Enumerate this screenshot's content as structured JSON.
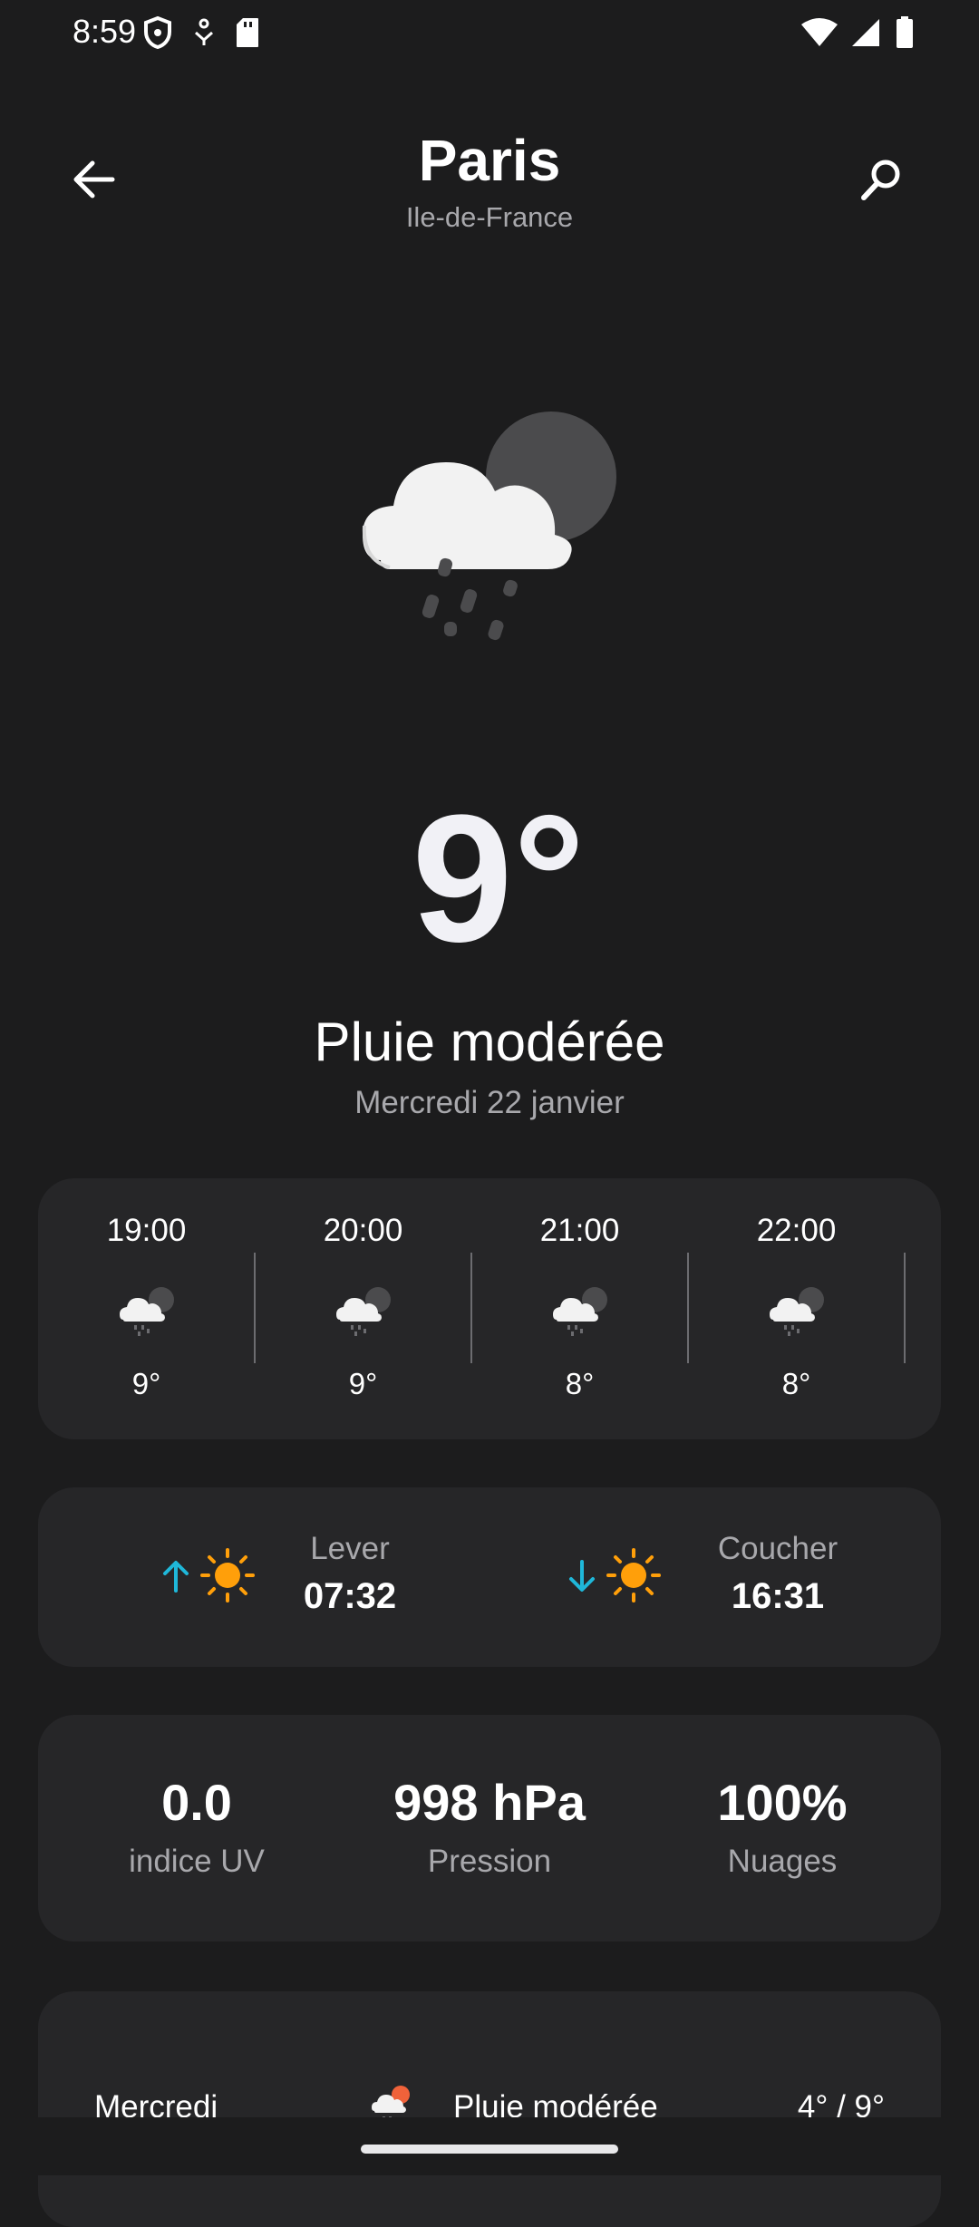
{
  "status_bar": {
    "time": "8:59",
    "left_icons": [
      "shield-icon",
      "accessibility-icon",
      "sd-card-icon"
    ],
    "right_icons": [
      "wifi-icon",
      "cell-signal-icon",
      "battery-icon"
    ]
  },
  "header": {
    "back_icon": "arrow-left-icon",
    "city": "Paris",
    "region": "Ile-de-France",
    "search_icon": "search-icon"
  },
  "current": {
    "icon": "cloud-rain-night-icon",
    "temperature": "9°",
    "condition": "Pluie modérée",
    "date": "Mercredi 22 janvier"
  },
  "hourly": [
    {
      "time": "19:00",
      "icon": "cloud-rain-night-icon",
      "temp": "9°"
    },
    {
      "time": "20:00",
      "icon": "cloud-rain-night-icon",
      "temp": "9°"
    },
    {
      "time": "21:00",
      "icon": "cloud-rain-night-icon",
      "temp": "8°"
    },
    {
      "time": "22:00",
      "icon": "cloud-rain-night-icon",
      "temp": "8°"
    }
  ],
  "sun": {
    "sunrise": {
      "label": "Lever",
      "time": "07:32",
      "arrow_icon": "arrow-up-icon",
      "icon": "sun-icon"
    },
    "sunset": {
      "label": "Coucher",
      "time": "16:31",
      "arrow_icon": "arrow-down-icon",
      "icon": "sun-icon"
    }
  },
  "stats": [
    {
      "value": "0.0",
      "label": "indice UV"
    },
    {
      "value": "998 hPa",
      "label": "Pression"
    },
    {
      "value": "100%",
      "label": "Nuages"
    }
  ],
  "daily": [
    {
      "day": "Mercredi",
      "icon": "cloud-rain-day-icon",
      "condition": "Pluie modérée",
      "range": "4° / 9°"
    }
  ],
  "colors": {
    "background": "#1c1c1d",
    "card": "#262628",
    "text_primary": "#ffffff",
    "text_secondary": "#a8a8ac",
    "sun": "#ff9f0a",
    "arrow_accent": "#1fb7d9"
  }
}
